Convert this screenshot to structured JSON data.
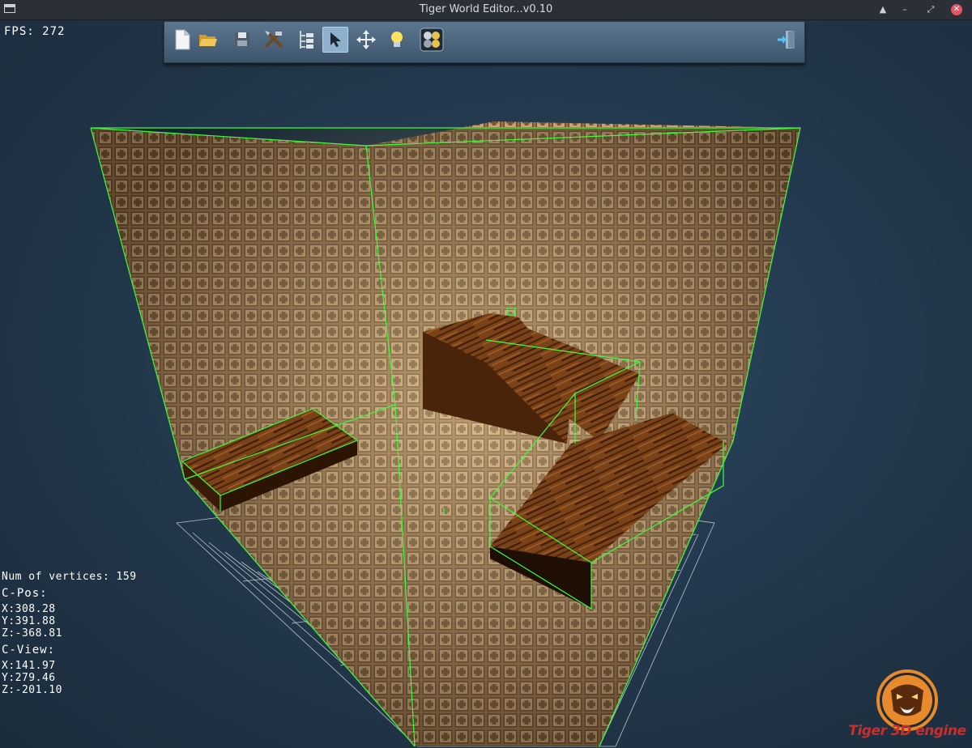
{
  "window": {
    "title": "Tiger World Editor...v0.10",
    "buttons": [
      "▲",
      "–",
      "⤢",
      "✕"
    ]
  },
  "viewport": {
    "fps_text": "FPS:  272",
    "num_vertices_text": "Num of vertices: 159",
    "cpos_label": "C-Pos:",
    "cpos_x": "X:308.28",
    "cpos_y": "Y:391.88",
    "cpos_z": "Z:-368.81",
    "cview_label": "C-View:",
    "cview_x": "X:141.97",
    "cview_y": "Y:279.46",
    "cview_z": "Z:-201.10"
  },
  "toolbar": {
    "tools": [
      {
        "icon": "new-file-icon",
        "active": false
      },
      {
        "icon": "open-folder-icon",
        "active": false
      },
      {
        "icon": "save-icon",
        "active": false
      },
      {
        "icon": "tools-icon",
        "active": false
      },
      {
        "icon": "hierarchy-tree-icon",
        "active": false
      },
      {
        "icon": "select-cursor-icon",
        "active": true
      },
      {
        "icon": "move-arrows-icon",
        "active": false
      },
      {
        "icon": "light-bulb-icon",
        "active": false
      },
      {
        "icon": "materials-icon",
        "active": false
      },
      {
        "icon": "exit-icon",
        "active": false
      }
    ]
  },
  "logo": {
    "text": "Tiger 3D engine"
  },
  "colors": {
    "background": "#23394d",
    "toolbar": "#4a6680",
    "wireframe": "#3cff3c",
    "grid": "#d8dde3",
    "brick": "#b98d5a",
    "wood": "#6e3a14",
    "logo_red": "#c9302c",
    "logo_orange": "#e88a2c"
  }
}
